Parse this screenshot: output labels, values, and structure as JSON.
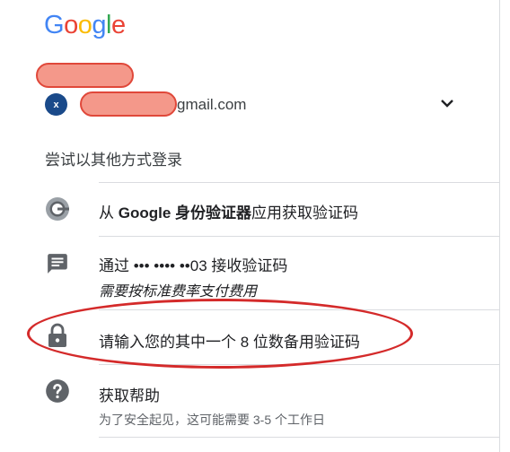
{
  "logo": {
    "letters": [
      "G",
      "o",
      "o",
      "g",
      "l",
      "e"
    ],
    "colors": [
      "#4285F4",
      "#EA4335",
      "#FBBC05",
      "#4285F4",
      "#34A853",
      "#EA4335"
    ]
  },
  "account": {
    "avatar_letter": "x",
    "email_suffix": "gmail.com",
    "chevron_icon": "chevron-down-icon"
  },
  "subtitle": "尝试以其他方式登录",
  "options": [
    {
      "icon": "authenticator-icon",
      "prefix": "从 ",
      "bold": "Google 身份验证器",
      "suffix": "应用获取验证码"
    },
    {
      "icon": "message-icon",
      "main": "通过 ••• •••• ••03 接收验证码",
      "sub": "需要按标准费率支付费用"
    },
    {
      "icon": "lock-icon",
      "main": "请输入您的其中一个 8 位数备用验证码"
    },
    {
      "icon": "help-icon",
      "main": "获取帮助",
      "sub": "为了安全起见，这可能需要 3-5 个工作日"
    }
  ],
  "colors": {
    "annotation": "#d42a2a",
    "redaction_fill": "#f4988a",
    "redaction_border": "#e0483a",
    "avatar": "#1a4a8a"
  }
}
